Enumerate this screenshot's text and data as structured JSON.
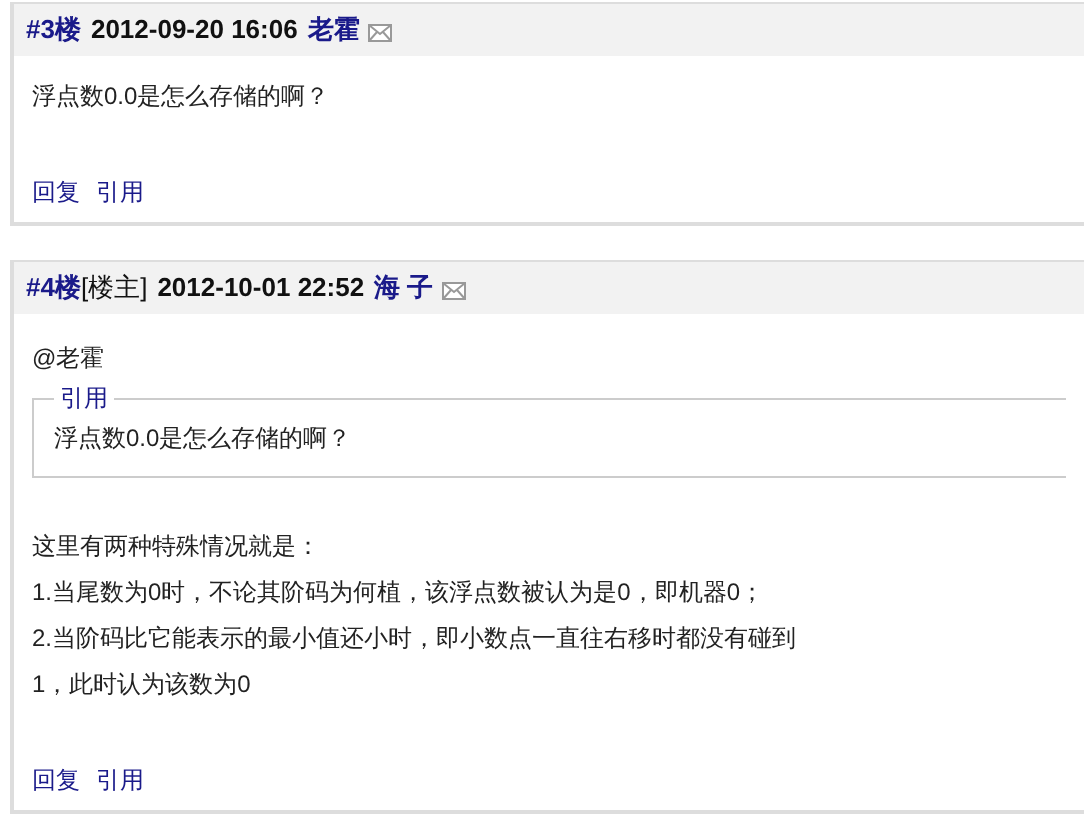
{
  "posts": [
    {
      "floor": "#3楼",
      "datetime": "2012-09-20 16:06",
      "author": "老霍",
      "body": [
        "浮点数0.0是怎么存储的啊？"
      ],
      "actions": [
        "回复",
        "引用"
      ]
    },
    {
      "floor": "#4楼",
      "op_tag": "[楼主]",
      "datetime": "2012-10-01 22:52",
      "author": "海 子",
      "mention": "@老霍",
      "quote": {
        "label": "引用",
        "text": "浮点数0.0是怎么存储的啊？"
      },
      "body": [
        "这里有两种特殊情况就是：",
        "1.当尾数为0时，不论其阶码为何植，该浮点数被认为是0，即机器0；",
        "2.当阶码比它能表示的最小值还小时，即小数点一直往右移时都没有碰到",
        "1，此时认为该数为0"
      ],
      "actions": [
        "回复",
        "引用"
      ]
    }
  ]
}
